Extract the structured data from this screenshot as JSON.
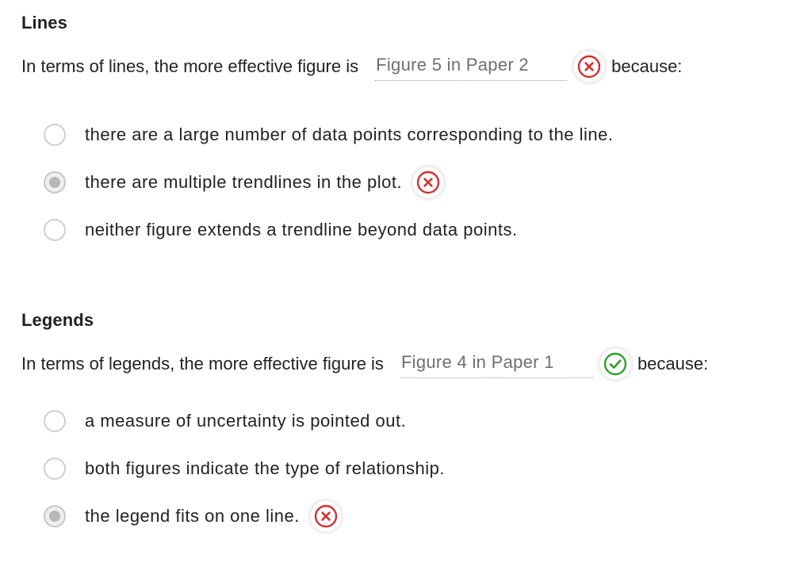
{
  "sections": [
    {
      "heading": "Lines",
      "prompt": "In terms of lines, the more effective figure is",
      "answer": "Figure 5 in Paper 2",
      "answer_status": "incorrect",
      "because": "because:",
      "options": [
        {
          "label": "there are a large number of data points corresponding to the line.",
          "selected": false,
          "status": null
        },
        {
          "label": "there are multiple trendlines in the plot.",
          "selected": true,
          "status": "incorrect"
        },
        {
          "label": "neither figure extends a trendline beyond data points.",
          "selected": false,
          "status": null
        }
      ]
    },
    {
      "heading": "Legends",
      "prompt": "In terms of legends, the more effective figure is",
      "answer": "Figure 4 in Paper 1",
      "answer_status": "correct",
      "because": "because:",
      "options": [
        {
          "label": "a measure of uncertainty is pointed out.",
          "selected": false,
          "status": null
        },
        {
          "label": "both figures indicate the type of relationship.",
          "selected": false,
          "status": null
        },
        {
          "label": "the legend fits on one line.",
          "selected": true,
          "status": "incorrect"
        }
      ]
    }
  ],
  "icons": {
    "incorrect": "x-circle-icon",
    "correct": "check-circle-icon"
  },
  "colors": {
    "incorrect": "#d32f2f",
    "correct": "#2e9e2e",
    "text": "#222222",
    "answer_text": "#6f6f6f"
  }
}
